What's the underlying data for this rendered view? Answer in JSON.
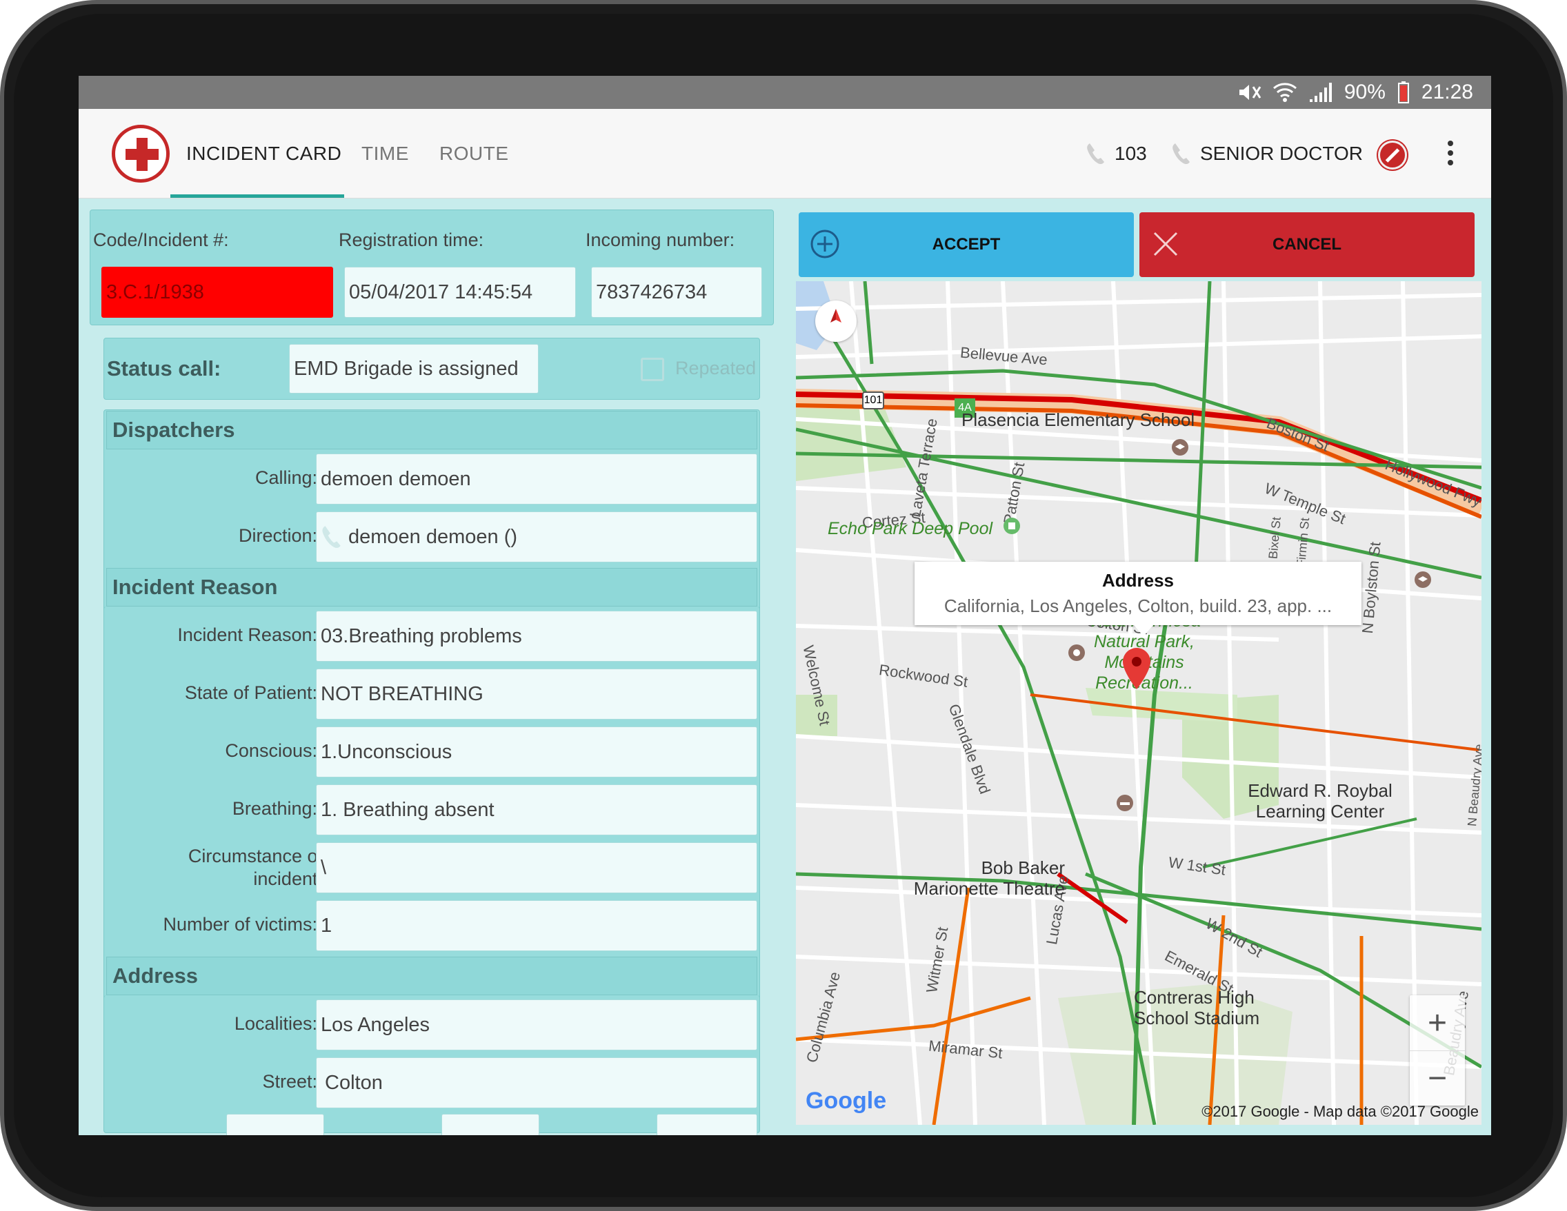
{
  "status_bar": {
    "battery": "90%",
    "time": "21:28"
  },
  "header": {
    "tabs": [
      {
        "label": "INCIDENT CARD",
        "active": true
      },
      {
        "label": "TIME",
        "active": false
      },
      {
        "label": "ROUTE",
        "active": false
      }
    ],
    "phone_number": "103",
    "role": "SENIOR DOCTOR"
  },
  "incident": {
    "code_label": "Code/Incident #:",
    "code_value": "3.C.1/1938",
    "reg_label": "Registration time:",
    "reg_value": "05/04/2017 14:45:54",
    "incoming_label": "Incoming number:",
    "incoming_value": "7837426734"
  },
  "status_call": {
    "label": "Status call:",
    "value": "EMD Brigade is assigned",
    "repeated_label": "Repeated"
  },
  "dispatchers": {
    "title": "Dispatchers",
    "calling_label": "Calling:",
    "calling_value": "demoen demoen",
    "direction_label": "Direction:",
    "direction_value": "demoen demoen ()"
  },
  "reason": {
    "title": "Incident Reason",
    "rows": [
      {
        "label": "Incident Reason:",
        "value": "03.Breathing problems"
      },
      {
        "label": "State of Patient:",
        "value": "NOT BREATHING"
      },
      {
        "label": "Conscious:",
        "value": "1.Unconscious"
      },
      {
        "label": "Breathing:",
        "value": "1. Breathing absent"
      },
      {
        "label": "Circumstance of incident:",
        "value": "\\"
      },
      {
        "label": "Number of victims:",
        "value": "1"
      }
    ]
  },
  "address": {
    "title": "Address",
    "localities_label": "Localities:",
    "localities_value": "Los Angeles",
    "street_label": "Street:",
    "street_value": "Colton"
  },
  "actions": {
    "accept": "ACCEPT",
    "cancel": "CANCEL"
  },
  "map": {
    "popup_title": "Address",
    "popup_text": "California, Los Angeles,  Colton, build. 23, app. ...",
    "streets": [
      "Bellevue Ave",
      "Boston St",
      "Hollywood Fwy",
      "W Temple St",
      "Cortez St",
      "Laveta Terrace",
      "Patton St",
      "Colton St",
      "Rockwood St",
      "Glendale Blvd",
      "Welcome St",
      "W 1st St",
      "W 2nd St",
      "Emerald St",
      "Lucas Ave",
      "Witmer St",
      "Columbia Ave",
      "Miramar St",
      "N Boylston St",
      "N Bixel St",
      "Firmin St",
      "N Beaudry Ave",
      "Beaudry Ave"
    ],
    "pois": [
      "Plasencia Elementary School",
      "Echo Park Deep Pool",
      "Edward R. Roybal Learning Center",
      "Vista Hermosa Natural Park, Mountains Recreation...",
      "Bob Baker Marionette Theatre",
      "Contreras High School Stadium"
    ],
    "shields": [
      "101",
      "4A"
    ],
    "google": "Google",
    "copyright": "©2017 Google - Map data ©2017 Google"
  }
}
